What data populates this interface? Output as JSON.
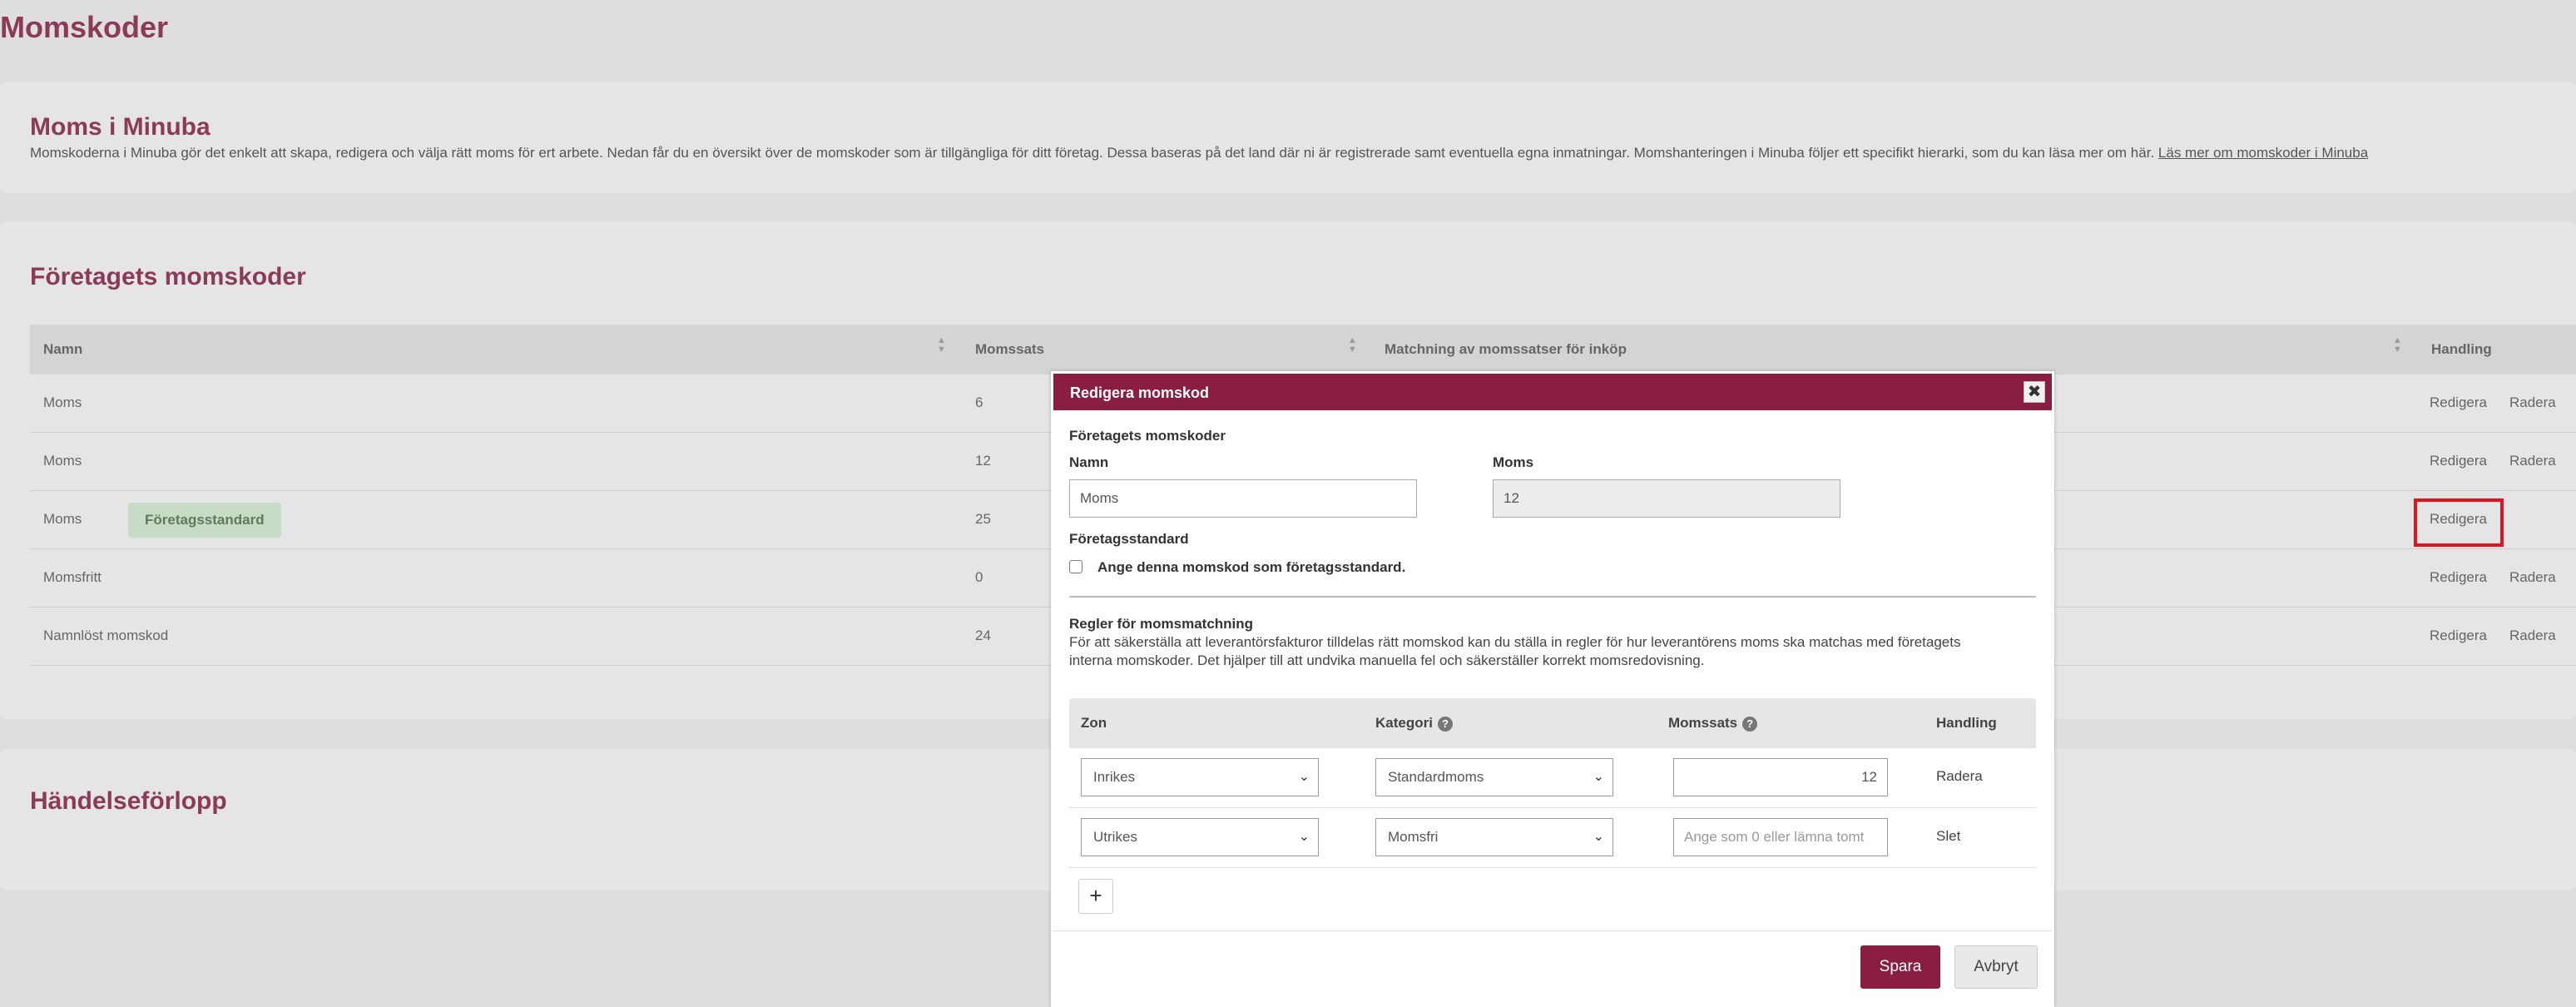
{
  "page": {
    "title": "Momskoder"
  },
  "info": {
    "title": "Moms i Minuba",
    "description": "Momskoderna i Minuba gör det enkelt att skapa, redigera och välja rätt moms för ert arbete. Nedan får du en översikt över de momskoder som är tillgängliga för ditt företag. Dessa baseras på det land där ni är registrerade samt eventuella egna inmatningar. Momshanteringen i Minuba följer ett specifikt hierarki, som du kan läsa mer om här.",
    "link": "Läs mer om momskoder i Minuba"
  },
  "codes": {
    "title": "Företagets momskoder",
    "headers": {
      "name": "Namn",
      "rate": "Momssats",
      "matching": "Matchning av momssatser för inköp",
      "action": "Handling"
    },
    "sort_arrows": "▲▼",
    "action_edit": "Redigera",
    "action_delete": "Radera",
    "rows": [
      {
        "name": "Moms",
        "rate": "6",
        "badge": ""
      },
      {
        "name": "Moms",
        "rate": "12",
        "badge": ""
      },
      {
        "name": "Moms",
        "rate": "25",
        "badge": "Företagsstandard"
      },
      {
        "name": "Momsfritt",
        "rate": "0",
        "badge": ""
      },
      {
        "name": "Namnlöst momskod",
        "rate": "24",
        "badge": ""
      }
    ]
  },
  "history": {
    "title": "Händelseförlopp"
  },
  "modal": {
    "title": "Redigera momskod",
    "close": "✖",
    "section_title": "Företagets momskoder",
    "name_label": "Namn",
    "name_value": "Moms",
    "moms_label": "Moms",
    "moms_value": "12",
    "standard_label": "Företagsstandard",
    "standard_checkbox": "Ange denna momskod som företagsstandard.",
    "rules_title": "Regler för momsmatchning",
    "rules_desc_1": "För att säkerställa att leverantörsfakturor tilldelas rätt momskod kan du ställa in regler för hur leverantörens moms ska matchas med företagets",
    "rules_desc_2": "interna momskoder. Det hjälper till att undvika manuella fel och säkerställer korrekt momsredovisning.",
    "rules_headers": {
      "zone": "Zon",
      "category": "Kategori",
      "rate": "Momssats",
      "action": "Handling"
    },
    "help_icon": "?",
    "rules": [
      {
        "zone": "Inrikes",
        "category": "Standardmoms",
        "rate": "12",
        "rate_placeholder": "",
        "action": "Radera"
      },
      {
        "zone": "Utrikes",
        "category": "Momsfri",
        "rate": "",
        "rate_placeholder": "Ange som 0 eller lämna tomt",
        "action": "Slet"
      }
    ],
    "add": "+",
    "save": "Spara",
    "cancel": "Avbryt"
  }
}
